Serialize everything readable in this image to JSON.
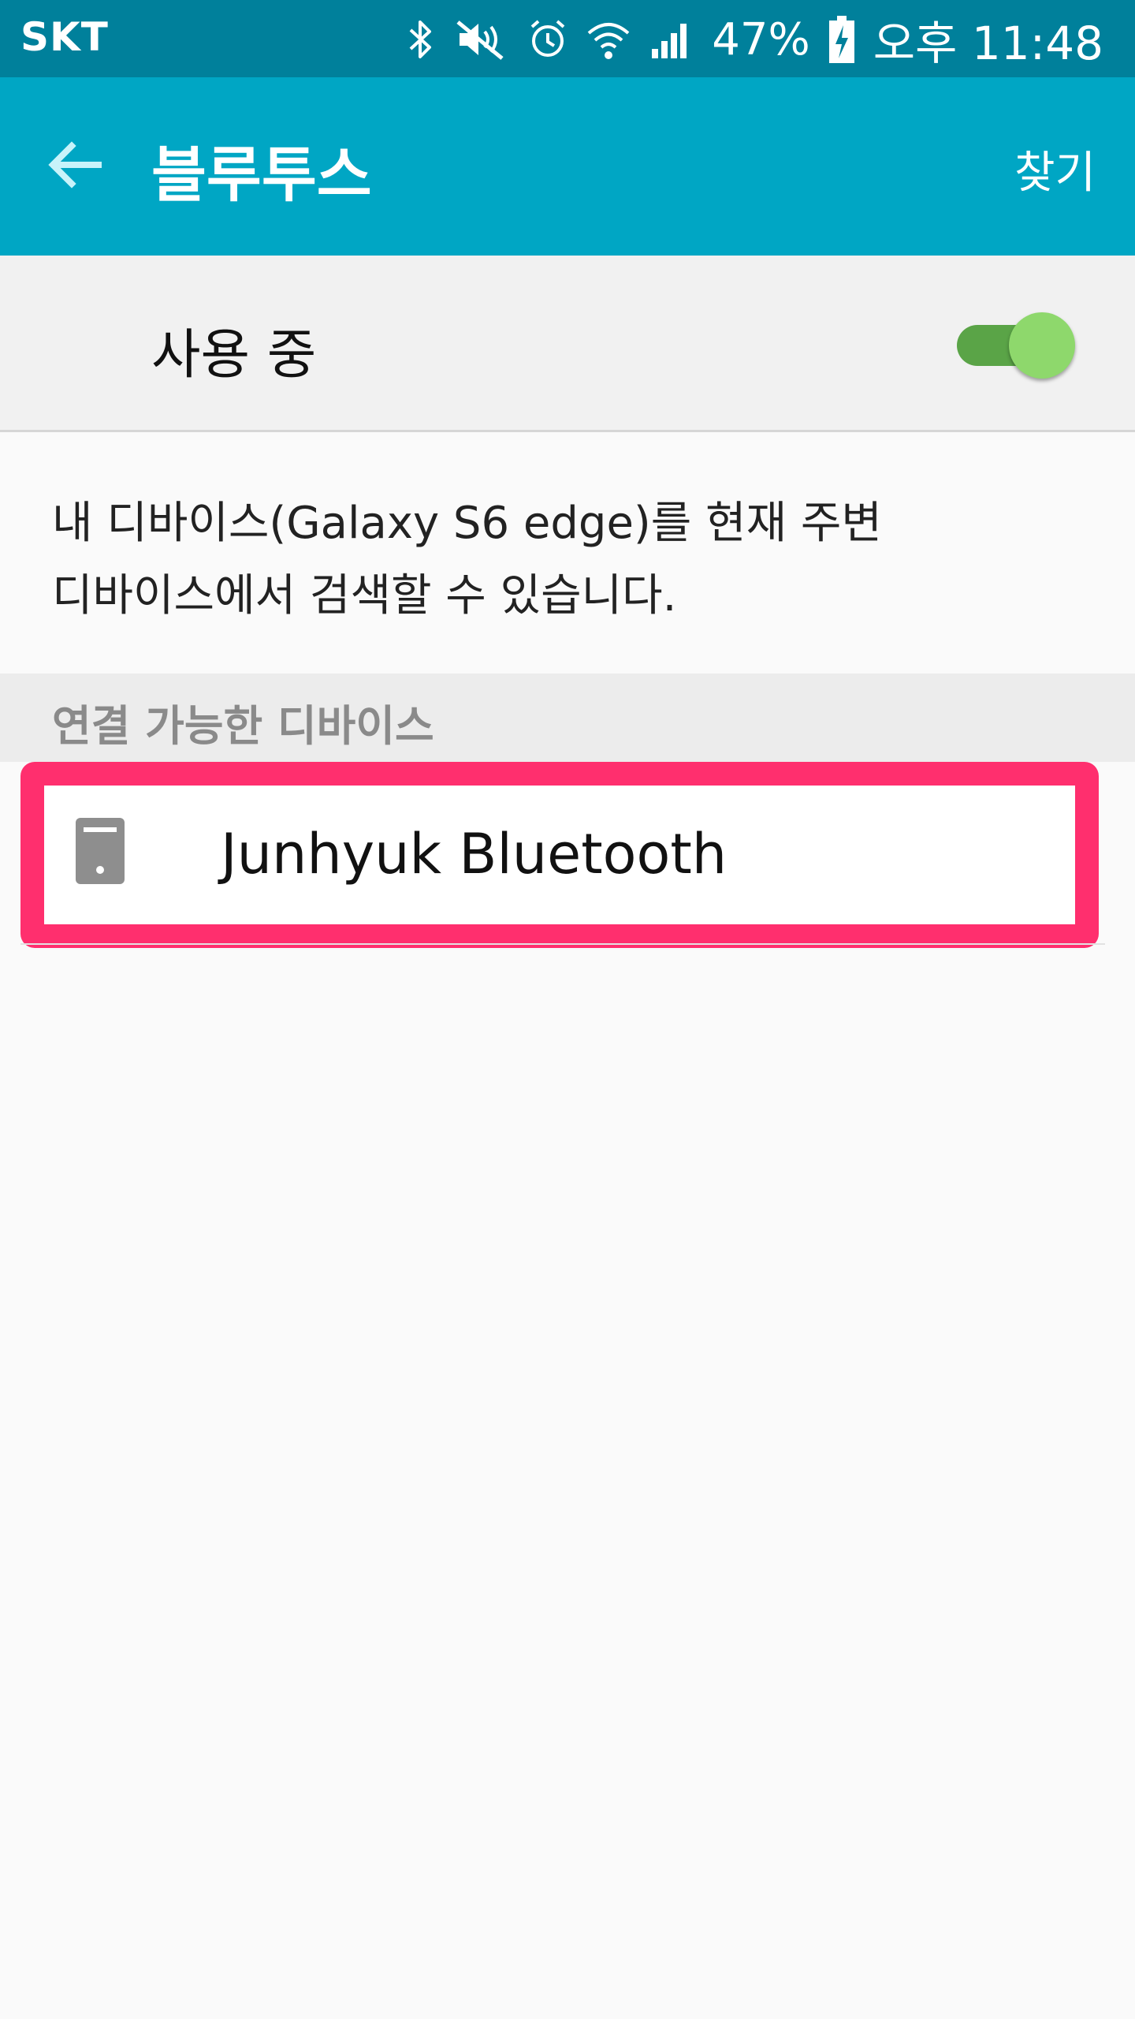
{
  "status_bar": {
    "carrier": "SKT",
    "battery_percent": "47%",
    "time": "오후 11:48",
    "icons": [
      "bluetooth-icon",
      "mute-icon",
      "alarm-icon",
      "wifi-icon",
      "signal-icon",
      "battery-charging-icon"
    ]
  },
  "app_bar": {
    "back_icon": "arrow-left-icon",
    "title": "블루투스",
    "scan_label": "찾기",
    "color": "#00a6c4"
  },
  "bluetooth_toggle": {
    "label": "사용 중",
    "state": "on",
    "track_color": "#5aa447",
    "thumb_color": "#8ed86c"
  },
  "visibility_notice": {
    "line1": "내 디바이스(Galaxy S6 edge)를 현재 주변",
    "line2": "디바이스에서 검색할 수 있습니다."
  },
  "available_devices": {
    "header": "연결 가능한 디바이스",
    "devices": [
      {
        "name": "Junhyuk Bluetooth",
        "icon": "phone-device-icon",
        "highlighted": true
      }
    ],
    "highlight_color": "#ff2f6e"
  }
}
